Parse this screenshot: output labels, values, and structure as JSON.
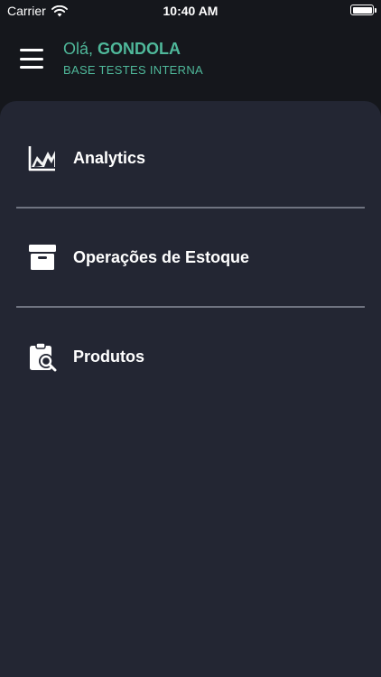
{
  "status_bar": {
    "carrier": "Carrier",
    "time": "10:40 AM"
  },
  "header": {
    "greeting_prefix": "Olá,",
    "user_name": "GONDOLA",
    "store_name": "BASE TESTES INTERNA",
    "accent_color": "#4fb89a"
  },
  "menu": {
    "items": [
      {
        "label": "Analytics",
        "icon": "chart-line-icon"
      },
      {
        "label": "Operações de Estoque",
        "icon": "archive-box-icon"
      },
      {
        "label": "Produtos",
        "icon": "clipboard-search-icon"
      }
    ]
  }
}
